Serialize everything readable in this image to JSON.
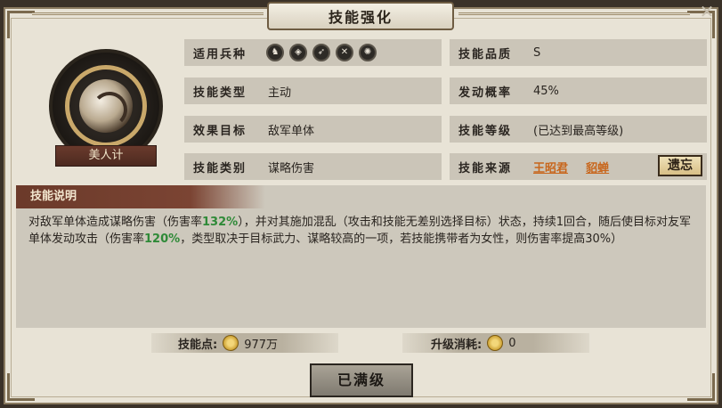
{
  "header": {
    "title": "技能强化"
  },
  "skill": {
    "name": "美人计"
  },
  "info": {
    "troop_label": "适用兵种",
    "troop_icons": [
      "cavalry-icon",
      "shield-icon",
      "bow-icon",
      "spear-icon",
      "siege-icon"
    ],
    "quality_label": "技能品质",
    "quality_value": "S",
    "type_label": "技能类型",
    "type_value": "主动",
    "rate_label": "发动概率",
    "rate_value": "45%",
    "target_label": "效果目标",
    "target_value": "敌军单体",
    "level_label": "技能等级",
    "level_value": "(已达到最高等级)",
    "category_label": "技能类别",
    "category_value": "谋略伤害",
    "source_label": "技能来源",
    "source_links": [
      "王昭君",
      "貂蝉"
    ],
    "forget_label": "遗忘"
  },
  "description": {
    "title": "技能说明",
    "p1": "对敌军单体造成谋略伤害（伤害率",
    "h1": "132%",
    "p2": "），并对其施加混乱（攻击和技能无差别选择目标）状态，持续1回合，随后使目标对友军单体发动攻击（伤害率",
    "h2": "120%",
    "p3": "，类型取决于目标武力、谋略较高的一项，若技能携带者为女性，则伤害率提高30%）"
  },
  "costs": {
    "points_label": "技能点:",
    "points_value": "977万",
    "upgrade_label": "升级消耗:",
    "upgrade_value": "0"
  },
  "buttons": {
    "max_level": "已满级",
    "close": "✕"
  },
  "colors": {
    "highlight": "#2f8a38",
    "source_link": "#c8661c",
    "title_band": "#6b3a2a"
  }
}
